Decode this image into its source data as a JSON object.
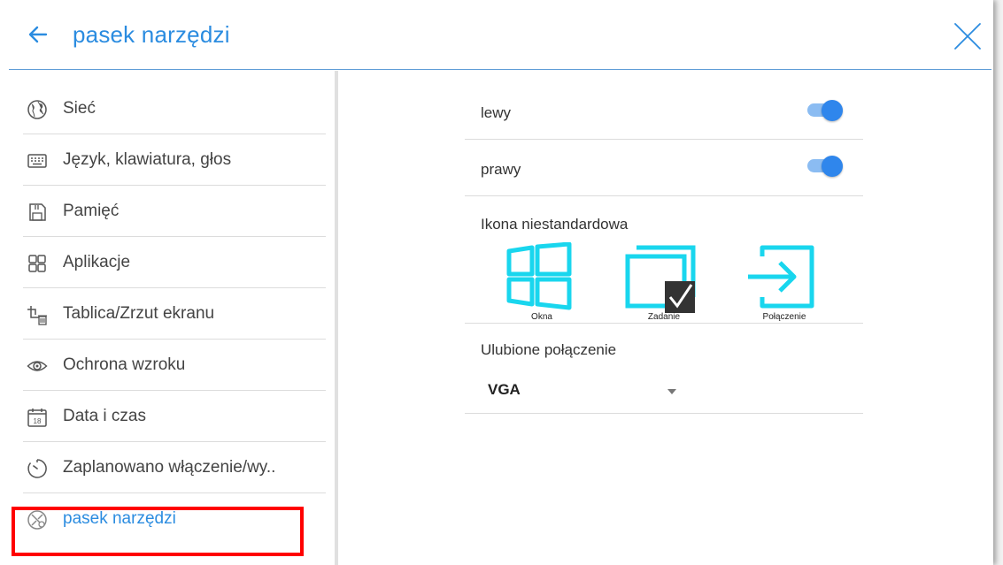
{
  "header": {
    "title": "pasek narzędzi",
    "accent": "#2b8ce0"
  },
  "sidebar": {
    "items": [
      {
        "label": "Sieć",
        "icon": "globe-icon"
      },
      {
        "label": "Język, klawiatura, głos",
        "icon": "keyboard-icon"
      },
      {
        "label": "Pamięć",
        "icon": "storage-icon"
      },
      {
        "label": "Aplikacje",
        "icon": "apps-grid-icon"
      },
      {
        "label": "Tablica/Zrzut ekranu",
        "icon": "crop-trash-icon"
      },
      {
        "label": "Ochrona wzroku",
        "icon": "eye-icon"
      },
      {
        "label": "Data i czas",
        "icon": "calendar-icon",
        "calendar_day": "18"
      },
      {
        "label": "Zaplanowano włączenie/wy..",
        "icon": "timer-icon"
      },
      {
        "label": "pasek narzędzi",
        "icon": "toolbar-icon",
        "active": true
      }
    ]
  },
  "content": {
    "left_toggle": {
      "label": "lewy",
      "on": true
    },
    "right_toggle": {
      "label": "prawy",
      "on": true
    },
    "custom_icon": {
      "label": "Ikona niestandardowa",
      "options": [
        {
          "caption": "Okna",
          "icon": "windows-icon"
        },
        {
          "caption": "Zadanie",
          "icon": "task-windows-icon",
          "selected": true
        },
        {
          "caption": "Połączenie",
          "icon": "input-connect-icon"
        }
      ],
      "icon_color": "#19d6ee"
    },
    "favorite_connection": {
      "label": "Ulubione połączenie",
      "value": "VGA"
    }
  },
  "colors": {
    "highlight": "#ff0000",
    "toggle_on": "#2f86ec"
  }
}
